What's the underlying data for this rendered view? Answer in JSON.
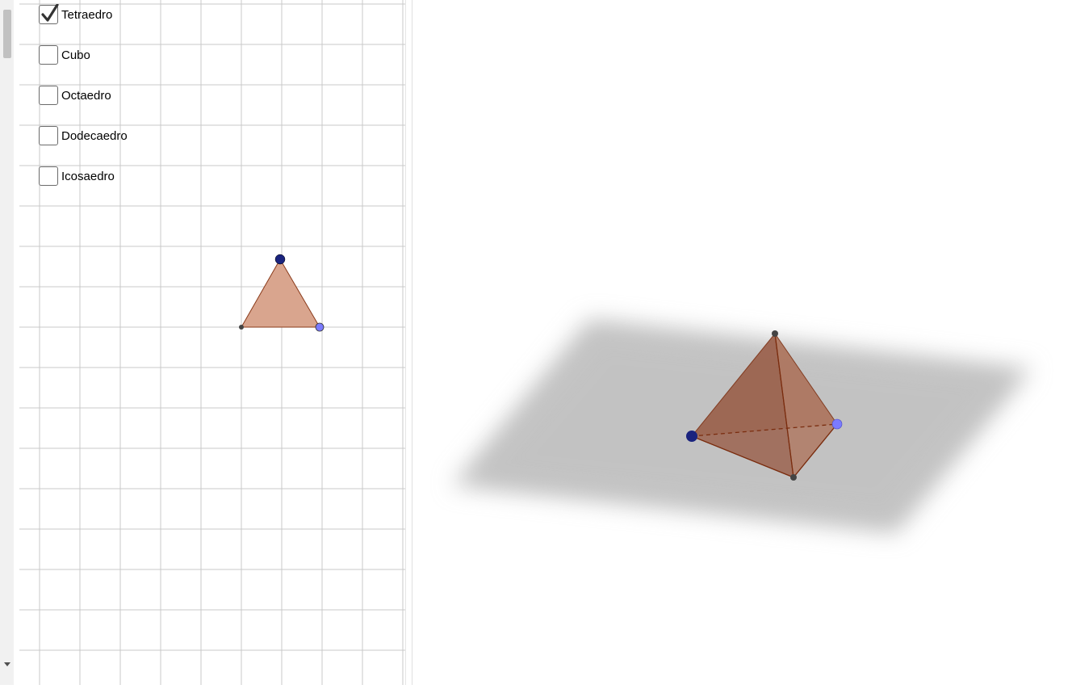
{
  "checkboxes": [
    {
      "label": "Tetraedro",
      "checked": true
    },
    {
      "label": "Cubo",
      "checked": false
    },
    {
      "label": "Octaedro",
      "checked": false
    },
    {
      "label": "Dodecaedro",
      "checked": false
    },
    {
      "label": "Icosaedro",
      "checked": false
    }
  ],
  "colors": {
    "grid": "#c8c8c8",
    "face_fill": "#d9a58e",
    "face_stroke": "#8a3a1a",
    "point_dark_blue": "#1a237e",
    "point_light_blue": "#7b7bff",
    "point_black": "#444444",
    "plane": "#c9c9c9"
  },
  "icons": [
    "checkmark-icon",
    "scroll-down-arrow-icon"
  ]
}
